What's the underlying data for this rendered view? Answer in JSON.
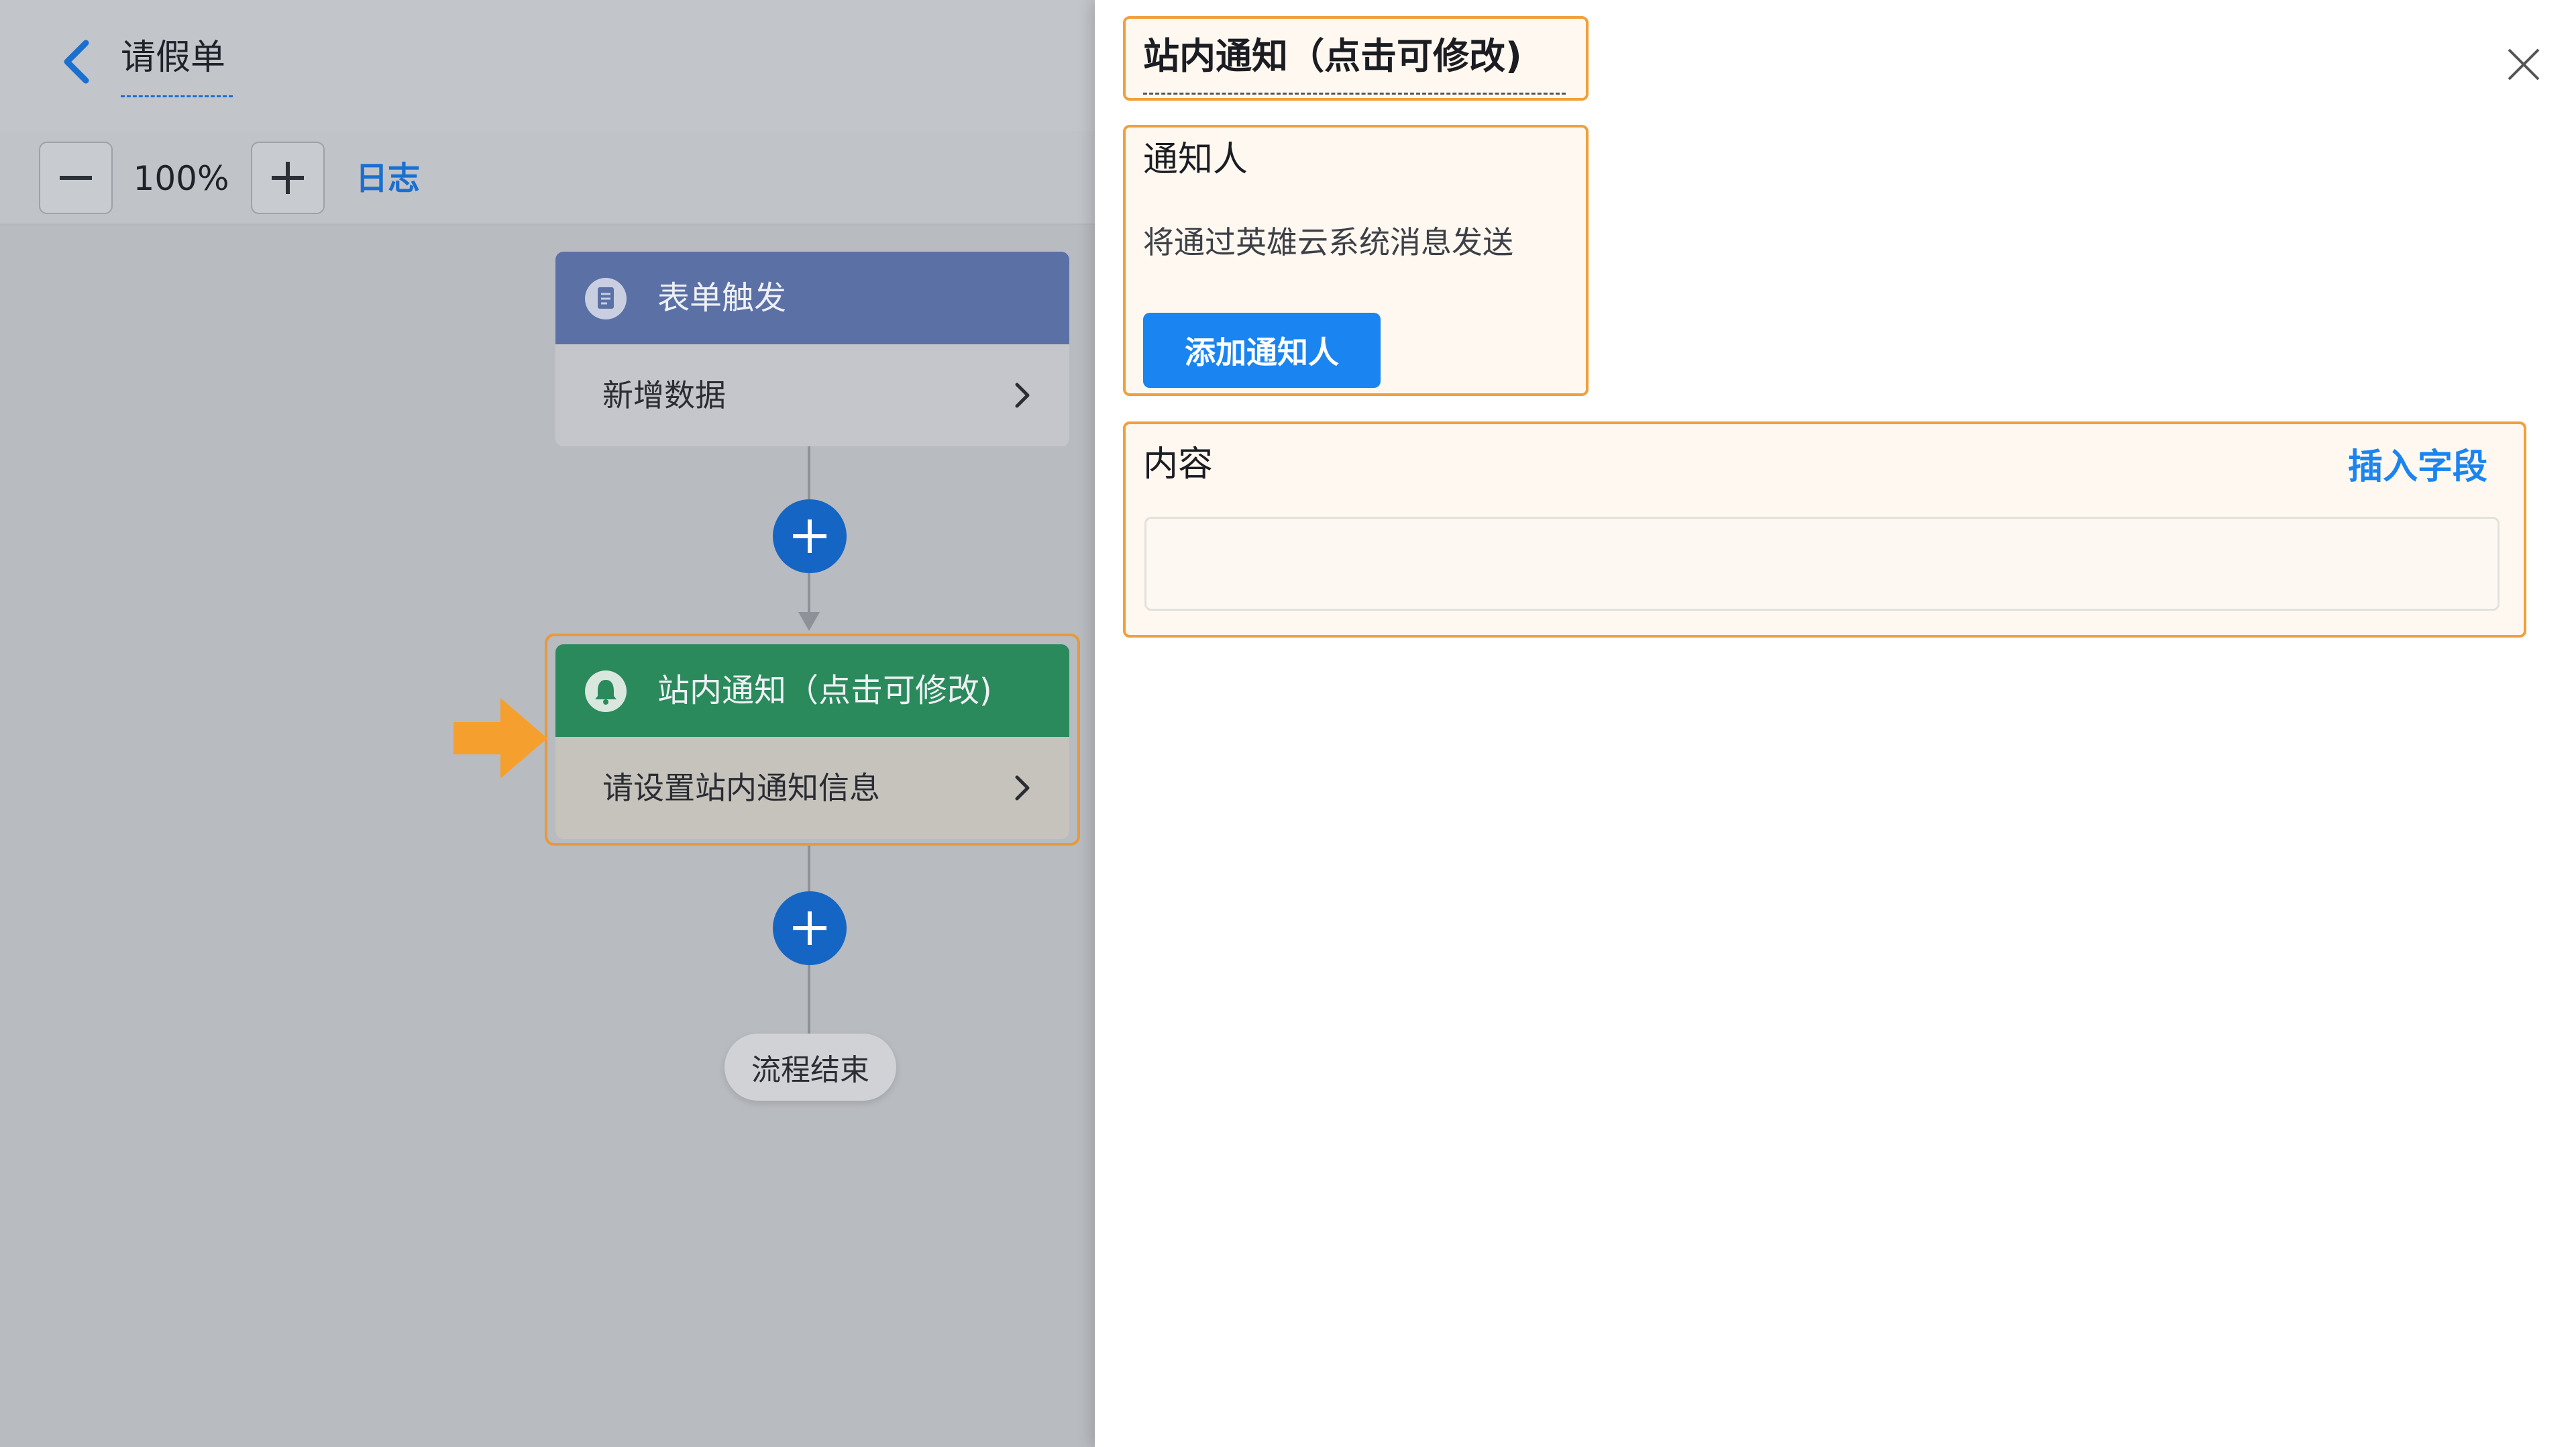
{
  "header": {
    "title": "请假单"
  },
  "toolbar": {
    "zoom_out": "—",
    "zoom_level": "100%",
    "zoom_in": "+",
    "log_link": "日志"
  },
  "workflow": {
    "trigger_node": {
      "title": "表单触发",
      "subtitle": "新增数据"
    },
    "notify_node": {
      "title": "站内通知（点击可修改)",
      "subtitle": "请设置站内通知信息"
    },
    "end_label": "流程结束"
  },
  "panel": {
    "title": "站内通知（点击可修改)",
    "notifier": {
      "label": "通知人",
      "description": "将通过英雄云系统消息发送",
      "add_button": "添加通知人"
    },
    "content": {
      "label": "内容",
      "insert_field": "插入字段",
      "value": ""
    }
  },
  "colors": {
    "accent_blue": "#1a84f0",
    "highlight_orange": "#f0a03c",
    "trigger_header": "#5b70a5",
    "notify_header": "#2a8a5b"
  }
}
